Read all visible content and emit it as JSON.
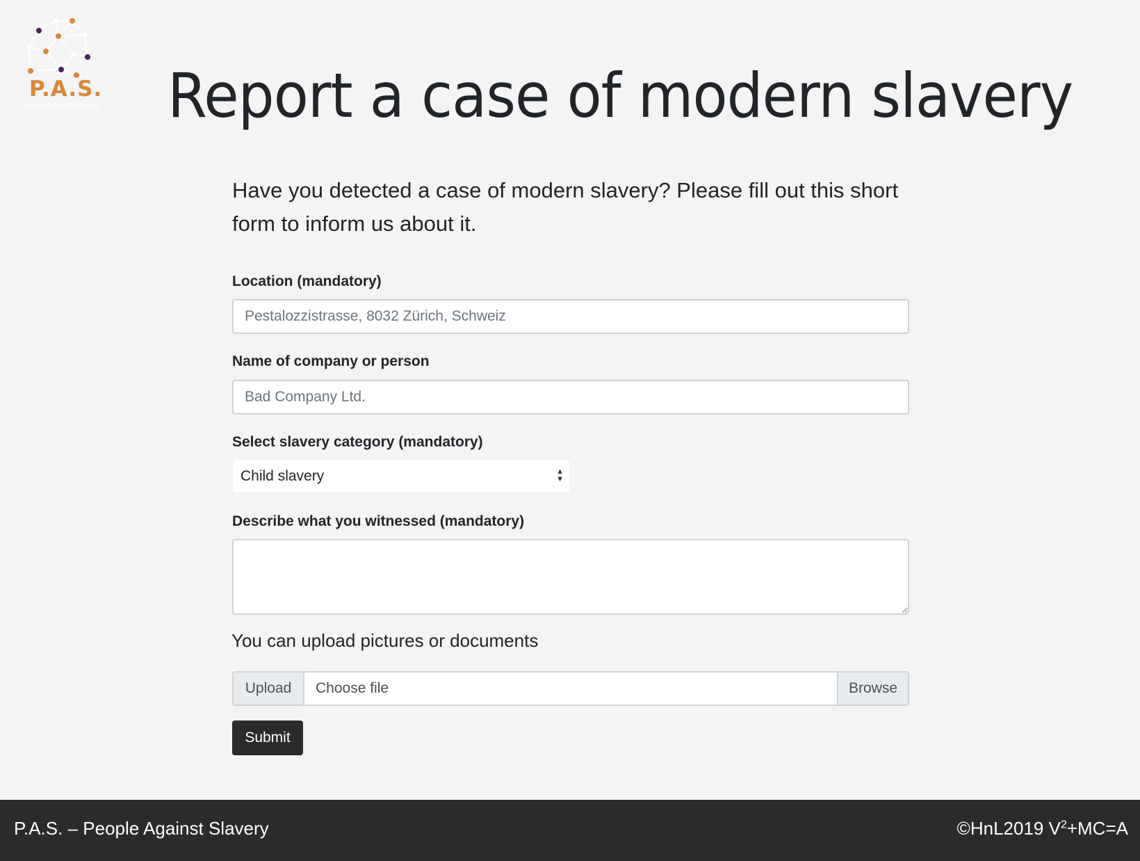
{
  "logo": {
    "text": "P.A.S.",
    "subtitle": "People Against Slavery",
    "accent": "#d8883a",
    "secondary": "#4a1f5c"
  },
  "page_title": "Report a case of modern slavery",
  "lead": "Have you detected a case of modern slavery? Please fill out this short form to inform us about it.",
  "form": {
    "location": {
      "label": "Location (mandatory)",
      "placeholder": "Pestalozzistrasse, 8032 Zürich, Schweiz"
    },
    "name": {
      "label": "Name of company or person",
      "placeholder": "Bad Company Ltd."
    },
    "category": {
      "label": "Select slavery category (mandatory)",
      "selected": "Child slavery"
    },
    "description": {
      "label": "Describe what you witnessed (mandatory)"
    },
    "upload": {
      "hint": "You can upload pictures or documents",
      "prepend": "Upload",
      "file_label": "Choose file",
      "browse": "Browse"
    },
    "submit_label": "Submit"
  },
  "footer": {
    "brand": "P.A.S.",
    "tagline": " – People Against Slavery",
    "copyright_prefix": "©HnL2019 V",
    "copyright_sup": "2",
    "copyright_suffix": "+MC=A"
  }
}
